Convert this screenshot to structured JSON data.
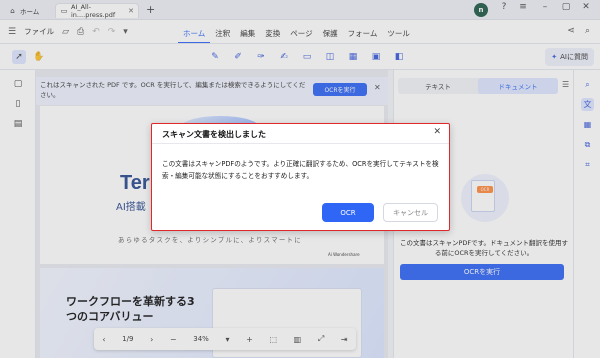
{
  "tabs": {
    "home_label": "ホーム",
    "doc_label": "AI_All-in....press.pdf",
    "new_tab": "+"
  },
  "window": {
    "avatar_initial": "n"
  },
  "menubar": {
    "file_label": "ファイル",
    "menus": [
      "ホーム",
      "注釈",
      "編集",
      "変換",
      "ページ",
      "保護",
      "フォーム",
      "ツール"
    ],
    "active_menu": "ホーム"
  },
  "toolbar": {
    "ai_label": "AIに質問"
  },
  "banner": {
    "text": "これはスキャンされた PDF です。OCR を実行して、編集または検索できるようにしてください。",
    "ocr_button": "OCRを実行"
  },
  "document": {
    "page1_title": "Ter",
    "page1_subtitle": "AI搭載",
    "page1_tagline": "あらゆるタスクを、よりシンプルに、よりスマートに",
    "page1_brand": "Ai Wondershare",
    "page2_heading_line1": "ワークフローを革新する3",
    "page2_heading_line2": "つのコアバリュー"
  },
  "zoombar": {
    "page_indicator": "1/9",
    "zoom_level": "34%"
  },
  "right_panel": {
    "tab_text": "テキスト",
    "tab_document": "ドキュメント",
    "active_tab": "ドキュメント",
    "illustration_badge": "OCR",
    "description": "この文書はスキャンPDFです。ドキュメント翻訳を使用する前にOCRを実行してください。",
    "ocr_button": "OCRを実行"
  },
  "dialog": {
    "title": "スキャン文書を検出しました",
    "body": "この文書はスキャンPDFのようです。より正確に翻訳するため、OCRを実行してテキストを検索・編集可能な状態にすることをおすすめします。",
    "ocr_button": "OCR",
    "cancel_button": "キャンセル"
  },
  "colors": {
    "accent": "#2f66f5",
    "dialog_border": "#e0282a"
  }
}
